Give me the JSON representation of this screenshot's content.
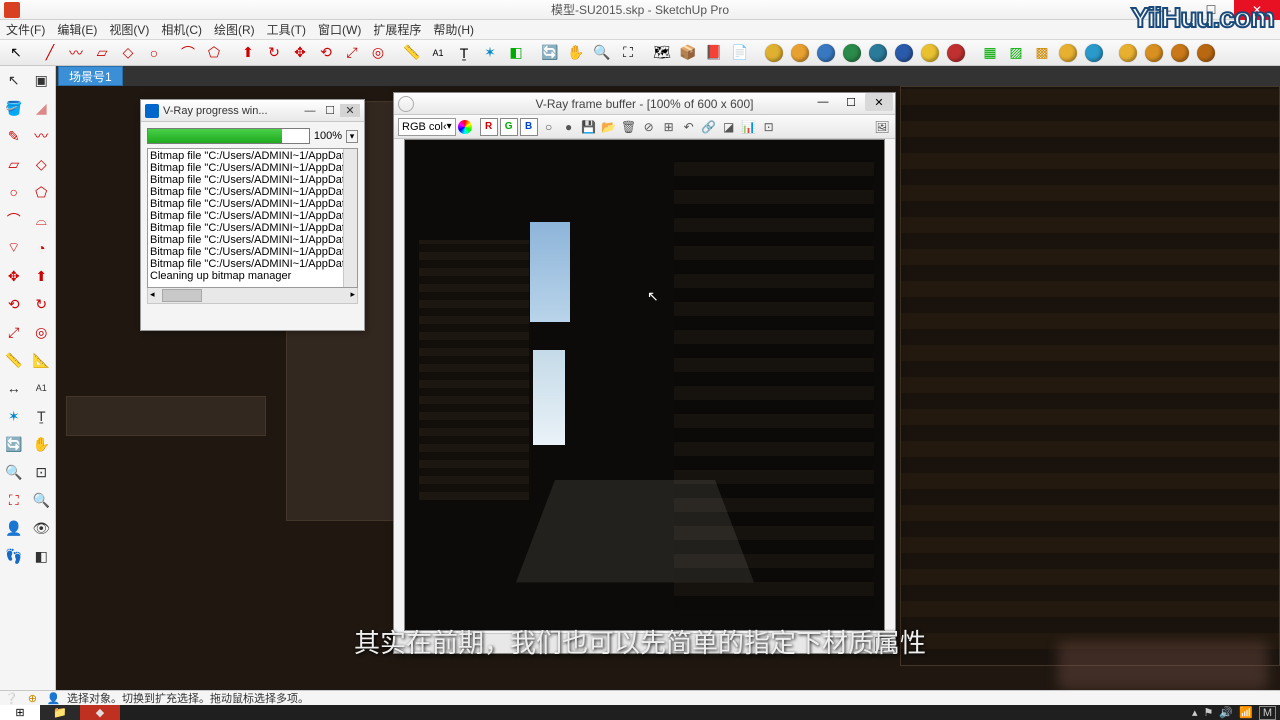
{
  "app": {
    "title": "模型-SU2015.skp - SketchUp Pro",
    "watermark": "YiiHuu.com"
  },
  "menu": [
    "文件(F)",
    "编辑(E)",
    "视图(V)",
    "相机(C)",
    "绘图(R)",
    "工具(T)",
    "窗口(W)",
    "扩展程序",
    "帮助(H)"
  ],
  "scene_tab": "场景号1",
  "progress": {
    "title": "V-Ray progress win...",
    "percent": "100%",
    "log": "Bitmap file \"C:/Users/ADMINI~1/AppData/\nBitmap file \"C:/Users/ADMINI~1/AppData/\nBitmap file \"C:/Users/ADMINI~1/AppData/\nBitmap file \"C:/Users/ADMINI~1/AppData/\nBitmap file \"C:/Users/ADMINI~1/AppData/\nBitmap file \"C:/Users/ADMINI~1/AppData/\nBitmap file \"C:/Users/ADMINI~1/AppData/\nBitmap file \"C:/Users/ADMINI~1/AppData/\nBitmap file \"C:/Users/ADMINI~1/AppData/\nBitmap file \"C:/Users/ADMINI~1/AppData/\nCleaning up bitmap manager"
  },
  "vfb": {
    "title": "V-Ray frame buffer - [100% of 600 x 600]",
    "channel_sel": "RGB col‹",
    "ch": {
      "r": "R",
      "g": "G",
      "b": "B"
    }
  },
  "status": {
    "text": "选择对象。切换到扩充选择。拖动鼠标选择多项。"
  },
  "tray": {
    "m": "M"
  },
  "subtitle": "其实在前期，我们也可以先简单的指定下材质属性",
  "orbs": {
    "m": "#e0b030",
    "o": "#e8a030",
    "r": "#3878c0",
    "rt": "#2a8a4a",
    "br": "#2a7a9a",
    "q": "#2a5aaa",
    "y": "#e8c030",
    "t": "#c03030",
    "p": "#2a9aca",
    "s1": "#e8b030",
    "s2": "#d89020",
    "s3": "#c87818",
    "s4": "#b86810"
  }
}
